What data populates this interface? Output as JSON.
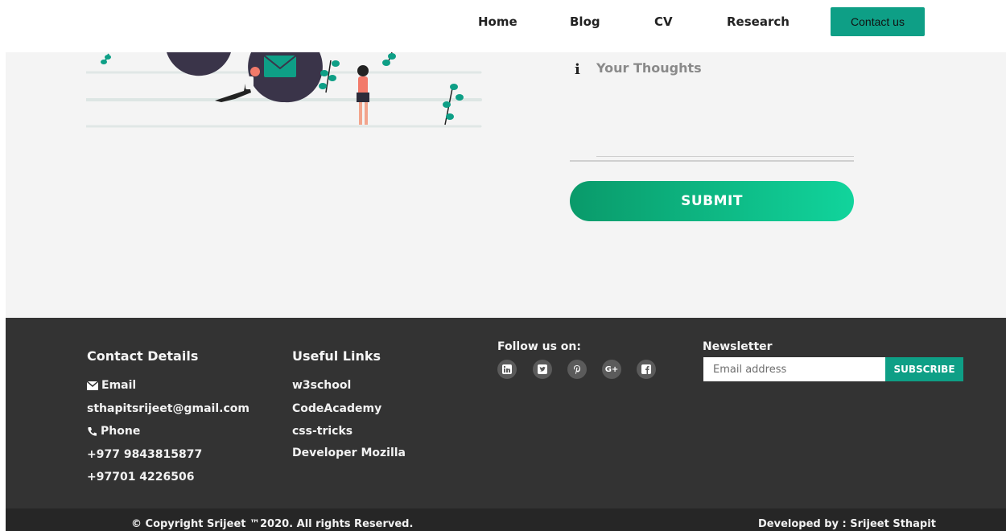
{
  "nav": {
    "items": [
      {
        "label": "Home"
      },
      {
        "label": "Blog"
      },
      {
        "label": "CV"
      },
      {
        "label": "Research"
      }
    ],
    "contact_label": "Contact us"
  },
  "form": {
    "thoughts_icon": "info-icon",
    "thoughts_placeholder": "Your Thoughts",
    "thoughts_value": "",
    "submit_label": "SUBMIT"
  },
  "footer": {
    "contact": {
      "title": "Contact Details",
      "email_label": "Email",
      "email_value": "sthapitsrijeet@gmail.com",
      "phone_label": "Phone",
      "phone_1": "+977 9843815877",
      "phone_2": "+97701 4226506"
    },
    "links": {
      "title": "Useful Links",
      "items": [
        "w3school",
        "CodeAcademy",
        "css-tricks",
        "Developer Mozilla"
      ]
    },
    "follow": {
      "title": "Follow us on:",
      "icons": [
        "linkedin-icon",
        "twitter-icon",
        "pinterest-icon",
        "google-plus-icon",
        "facebook-icon"
      ]
    },
    "newsletter": {
      "title": "Newsletter",
      "placeholder": "Email address",
      "button_label": "SUBSCRIBE"
    }
  },
  "bottom": {
    "copyright": "© Copyright Srijeet ™2020. All rights Reserved.",
    "developed_by": "Developed by : Srijeet Sthapit"
  },
  "colors": {
    "accent": "#0e9f86",
    "footer_bg": "#333333",
    "bottom_bg": "#262626",
    "content_bg": "#f4f4f4"
  }
}
